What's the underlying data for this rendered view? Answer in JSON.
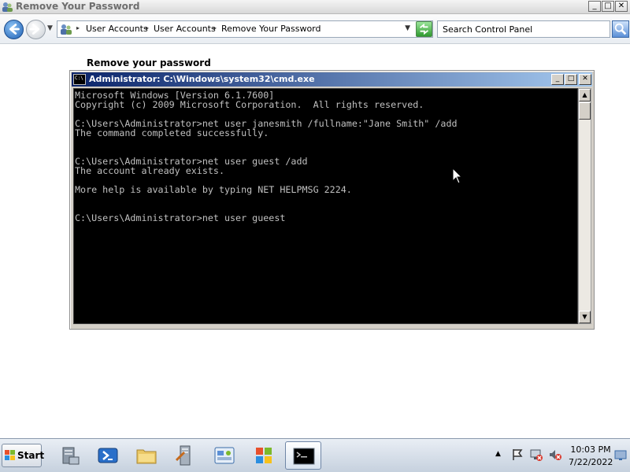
{
  "window": {
    "title": "Remove Your Password",
    "controls": {
      "minimize": "_",
      "maximize": "□",
      "close": "✕"
    }
  },
  "address_bar": {
    "breadcrumbs": [
      "User Accounts",
      "User Accounts",
      "Remove Your Password"
    ],
    "search_placeholder": "Search Control Panel"
  },
  "page": {
    "heading": "Remove your password"
  },
  "cmd": {
    "title": "Administrator: C:\\Windows\\system32\\cmd.exe",
    "icon_text": "C:\\",
    "lines": [
      "Microsoft Windows [Version 6.1.7600]",
      "Copyright (c) 2009 Microsoft Corporation.  All rights reserved.",
      "",
      "C:\\Users\\Administrator>net user janesmith /fullname:\"Jane Smith\" /add",
      "The command completed successfully.",
      "",
      "",
      "C:\\Users\\Administrator>net user guest /add",
      "The account already exists.",
      "",
      "More help is available by typing NET HELPMSG 2224.",
      "",
      "",
      "C:\\Users\\Administrator>net user gueest"
    ]
  },
  "taskbar": {
    "start_label": "Start",
    "apps": [
      "server-manager",
      "powershell",
      "file-explorer",
      "administrative-tools",
      "control-panel",
      "windows-media",
      "command-prompt"
    ],
    "active_app": "command-prompt",
    "clock": {
      "time": "10:03 PM",
      "date": "7/22/2022"
    }
  },
  "colors": {
    "console_bg": "#000000",
    "console_fg": "#c0c0c0",
    "cmd_titlebar": "#0a246a",
    "taskbar": "#c6d1de"
  }
}
